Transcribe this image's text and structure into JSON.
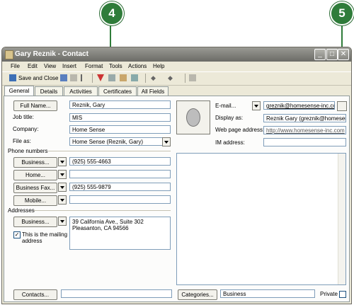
{
  "callouts": {
    "c4": "4",
    "c5": "5"
  },
  "window": {
    "title": "Gary Reznik - Contact",
    "controls": [
      "_",
      "□",
      "✕"
    ]
  },
  "menu": [
    "File",
    "Edit",
    "View",
    "Insert",
    "Format",
    "Tools",
    "Actions",
    "Help"
  ],
  "toolbar": {
    "save_close": "Save and Close"
  },
  "tabs": [
    "General",
    "Details",
    "Activities",
    "Certificates",
    "All Fields"
  ],
  "left": {
    "full_name_btn": "Full Name...",
    "full_name": "Reznik, Gary",
    "job_title_lbl": "Job title:",
    "job_title": "MIS",
    "company_lbl": "Company:",
    "company": "Home Sense",
    "file_as_lbl": "File as:",
    "file_as": "Home Sense (Reznik, Gary)",
    "phone_numbers": "Phone numbers",
    "phones": [
      {
        "label": "Business...",
        "value": "(925) 555-4663"
      },
      {
        "label": "Home...",
        "value": ""
      },
      {
        "label": "Business Fax...",
        "value": "(925) 555-9879"
      },
      {
        "label": "Mobile...",
        "value": ""
      }
    ],
    "addresses": "Addresses",
    "address_btn": "Business...",
    "address_line1": "39 California Ave., Suite 302",
    "address_line2": "Pleasanton, CA 94566",
    "mailing_check": "This is the mailing",
    "mailing_check2": "address"
  },
  "right": {
    "email_lbl": "E-mail...",
    "email": "greznik@homesense-inc.com",
    "display_as_lbl": "Display as:",
    "display_as": "Reznik Gary (greznik@homesense-",
    "web_lbl": "Web page address:",
    "web": "http://www.homesense-inc.com",
    "im_lbl": "IM address:",
    "im": ""
  },
  "bottom": {
    "contacts_btn": "Contacts...",
    "contacts": "",
    "categories_btn": "Categories...",
    "categories": "Business",
    "private": "Private"
  }
}
